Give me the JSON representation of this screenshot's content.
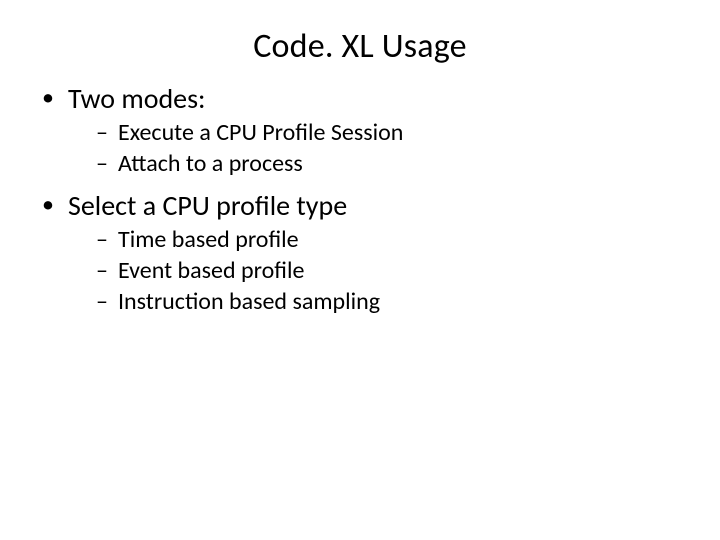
{
  "title": "Code. XL Usage",
  "bullets": [
    {
      "text": "Two modes:",
      "sub": [
        "Execute a CPU Profile Session",
        "Attach to a process"
      ]
    },
    {
      "text": "Select a CPU profile type",
      "sub": [
        "Time based profile",
        "Event based profile",
        "Instruction based sampling"
      ]
    }
  ]
}
